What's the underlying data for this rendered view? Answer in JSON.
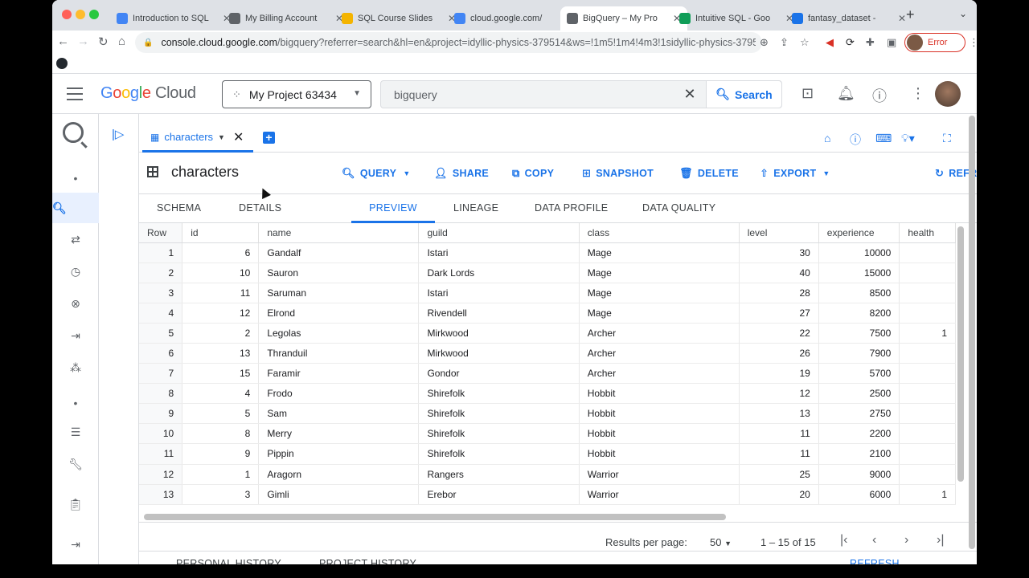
{
  "browser": {
    "tabs": [
      {
        "title": "Introduction to SQL",
        "color": "#4285f4"
      },
      {
        "title": "My Billing Account",
        "color": "#5f6368"
      },
      {
        "title": "SQL Course Slides",
        "color": "#f4b400"
      },
      {
        "title": "cloud.google.com/",
        "color": "#4285f4"
      },
      {
        "title": "BigQuery – My Pro",
        "color": "#5f6368"
      },
      {
        "title": "Intuitive SQL - Goo",
        "color": "#0f9d58"
      },
      {
        "title": "fantasy_dataset -",
        "color": "#1a73e8"
      }
    ],
    "url_host": "console.cloud.google.com",
    "url_path": "/bigquery?referrer=search&hl=en&project=idyllic-physics-379514&ws=!1m5!1m4!4m3!1sidyllic-physics-37951...",
    "error_label": "Error"
  },
  "header": {
    "logo_google": "Google",
    "logo_cloud": "Cloud",
    "project": "My Project 63434",
    "search_value": "bigquery",
    "search_button": "Search"
  },
  "editor_tab": {
    "label": "characters"
  },
  "table_header": {
    "name": "characters",
    "actions": {
      "query": "QUERY",
      "share": "SHARE",
      "copy": "COPY",
      "snapshot": "SNAPSHOT",
      "delete": "DELETE",
      "export": "EXPORT",
      "refresh": "REFRESH"
    }
  },
  "subtabs": [
    "SCHEMA",
    "DETAILS",
    "PREVIEW",
    "LINEAGE",
    "DATA PROFILE",
    "DATA QUALITY"
  ],
  "grid": {
    "columns": [
      "Row",
      "id",
      "name",
      "guild",
      "class",
      "level",
      "experience",
      "health"
    ],
    "rows": [
      [
        "1",
        "6",
        "Gandalf",
        "Istari",
        "Mage",
        "30",
        "10000",
        ""
      ],
      [
        "2",
        "10",
        "Sauron",
        "Dark Lords",
        "Mage",
        "40",
        "15000",
        ""
      ],
      [
        "3",
        "11",
        "Saruman",
        "Istari",
        "Mage",
        "28",
        "8500",
        ""
      ],
      [
        "4",
        "12",
        "Elrond",
        "Rivendell",
        "Mage",
        "27",
        "8200",
        ""
      ],
      [
        "5",
        "2",
        "Legolas",
        "Mirkwood",
        "Archer",
        "22",
        "7500",
        "1"
      ],
      [
        "6",
        "13",
        "Thranduil",
        "Mirkwood",
        "Archer",
        "26",
        "7900",
        ""
      ],
      [
        "7",
        "15",
        "Faramir",
        "Gondor",
        "Archer",
        "19",
        "5700",
        ""
      ],
      [
        "8",
        "4",
        "Frodo",
        "Shirefolk",
        "Hobbit",
        "12",
        "2500",
        ""
      ],
      [
        "9",
        "5",
        "Sam",
        "Shirefolk",
        "Hobbit",
        "13",
        "2750",
        ""
      ],
      [
        "10",
        "8",
        "Merry",
        "Shirefolk",
        "Hobbit",
        "11",
        "2200",
        ""
      ],
      [
        "11",
        "9",
        "Pippin",
        "Shirefolk",
        "Hobbit",
        "11",
        "2100",
        ""
      ],
      [
        "12",
        "1",
        "Aragorn",
        "Rangers",
        "Warrior",
        "25",
        "9000",
        ""
      ],
      [
        "13",
        "3",
        "Gimli",
        "Erebor",
        "Warrior",
        "20",
        "6000",
        "1"
      ]
    ]
  },
  "pager": {
    "label": "Results per page:",
    "per_page": "50",
    "range": "1 – 15 of 15"
  },
  "bottom": {
    "personal": "PERSONAL HISTORY",
    "project": "PROJECT HISTORY",
    "refresh": "REFRESH"
  }
}
